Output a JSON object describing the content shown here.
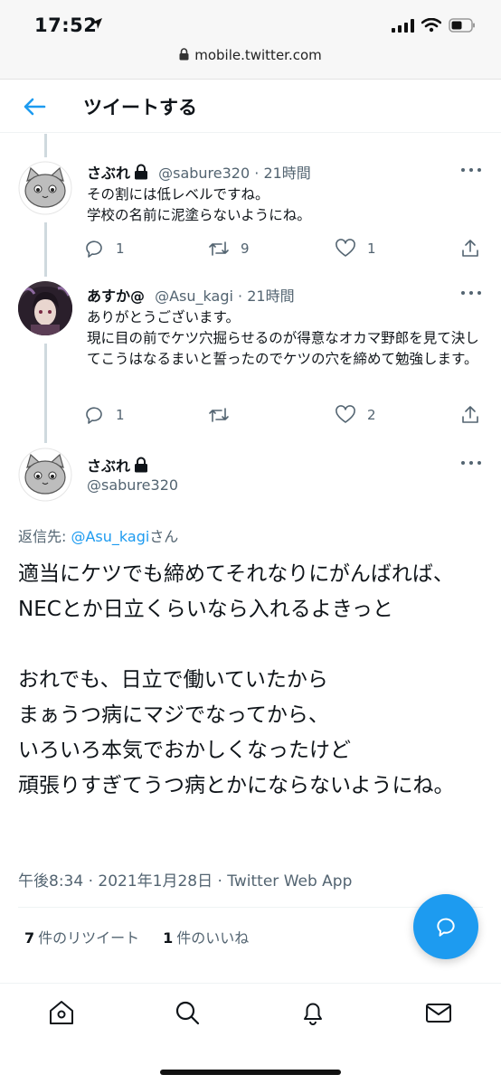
{
  "status_bar": {
    "time": "17:52",
    "url": "mobile.twitter.com"
  },
  "header": {
    "title": "ツイートする"
  },
  "tweets": [
    {
      "name": "さぶれ",
      "handle": "@sabure320",
      "dot": "·",
      "time": "21時間",
      "body": "その割には低レベルですね。\n学校の名前に泥塗らないようにね。",
      "replies": "1",
      "retweets": "9",
      "likes": "1"
    },
    {
      "name": "あすか@",
      "handle": "@Asu_kagi",
      "dot": "·",
      "time": "21時間",
      "body": "ありがとうございます。\n現に目の前でケツ穴掘らせるのが得意なオカマ野郎を見て決してこうはなるまいと誓ったのでケツの穴を締めて勉強します。",
      "replies": "1",
      "retweets": "",
      "likes": "2"
    }
  ],
  "main_tweet": {
    "name": "さぶれ",
    "handle": "@sabure320",
    "reply_prefix": "返信先: ",
    "reply_mention": "@Asu_kagi",
    "reply_suffix": "さん",
    "text": "適当にケツでも締めてそれなりにがんばれば、\nNECとか日立くらいなら入れるよきっと\n\nおれでも、日立で働いていたから\nまぁうつ病にマジでなってから、\nいろいろ本気でおかしくなったけど\n頑張りすぎてうつ病とかにならないようにね。",
    "meta": "午後8:34 · 2021年1月28日 · Twitter Web App",
    "retweet_count": "7",
    "retweet_label": "件のリツイート",
    "like_count": "1",
    "like_label": "件のいいね"
  },
  "colors": {
    "accent": "#1d9bf0",
    "secondary_text": "#536471",
    "divider": "#eff3f4"
  }
}
